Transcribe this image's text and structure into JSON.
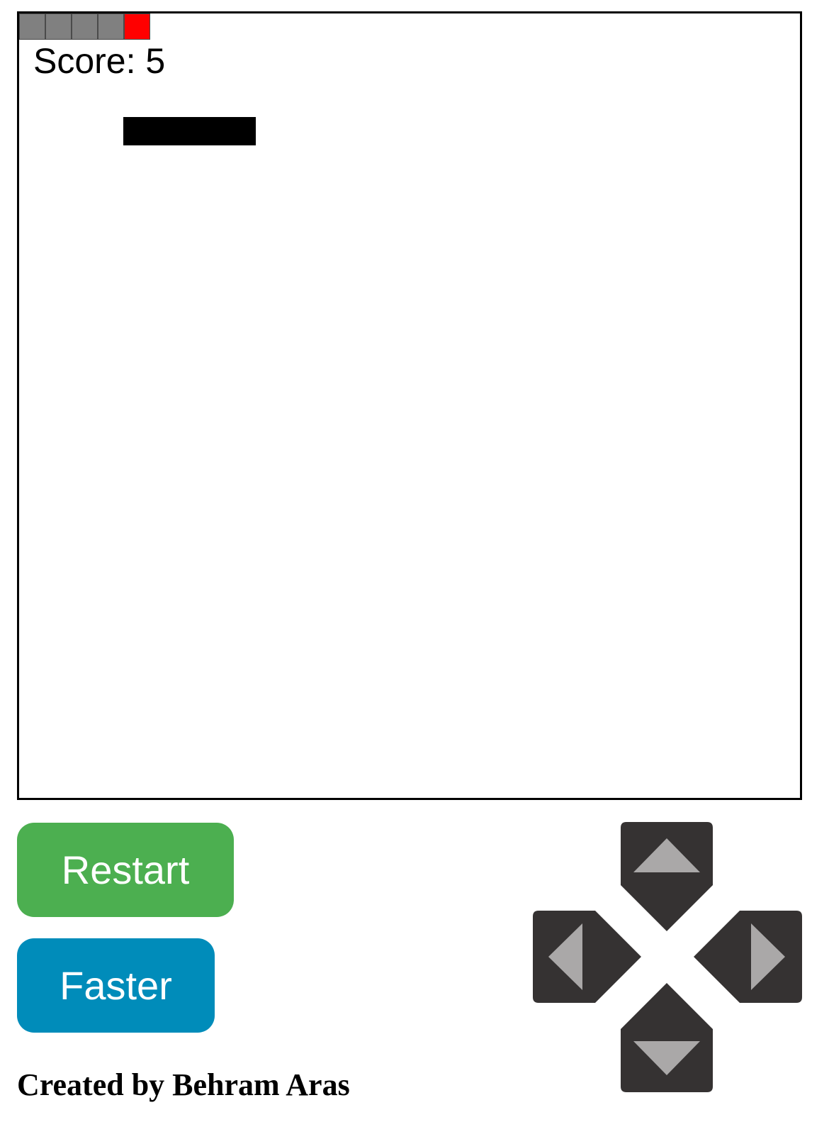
{
  "game": {
    "score_label": "Score: 5",
    "snake_color": "#808080",
    "snake_head_color": "#ff0000",
    "obstacle_color": "#000000"
  },
  "controls": {
    "restart_label": "Restart",
    "faster_label": "Faster",
    "restart_color": "#4caf50",
    "faster_color": "#008cba",
    "dpad_color": "#353232",
    "dpad_arrow_color": "#aaa8a8"
  },
  "footer": {
    "credit": "Created by Behram Aras"
  }
}
